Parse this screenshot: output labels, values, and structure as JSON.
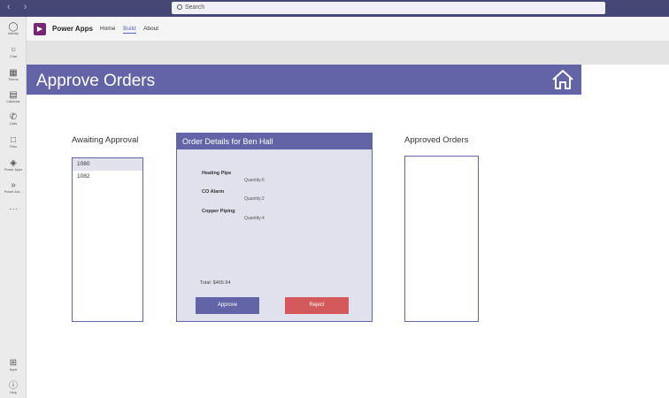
{
  "window": {
    "search_placeholder": "Search",
    "nav_arrows": "‹ ›"
  },
  "rail": {
    "items": [
      {
        "label": "Activity",
        "icon": "bell-icon"
      },
      {
        "label": "Chat",
        "icon": "chat-icon"
      },
      {
        "label": "Teams",
        "icon": "teams-icon"
      },
      {
        "label": "Calendar",
        "icon": "calendar-icon"
      },
      {
        "label": "Calls",
        "icon": "phone-icon"
      },
      {
        "label": "Files",
        "icon": "file-icon"
      },
      {
        "label": "Power Apps",
        "icon": "powerapps-icon"
      },
      {
        "label": "Power Aut...",
        "icon": "powerautomate-icon"
      }
    ],
    "more": "···",
    "apps_label": "Apps",
    "help_label": "Help"
  },
  "app": {
    "name": "Power Apps",
    "tabs": [
      {
        "label": "Home"
      },
      {
        "label": "Build"
      },
      {
        "label": "About"
      }
    ],
    "active_tab": "Build"
  },
  "screen": {
    "title": "Approve Orders",
    "awaiting_label": "Awaiting Approval",
    "awaiting_orders": [
      "1080",
      "1082"
    ],
    "approved_label": "Approved Orders",
    "approved_orders": [],
    "details": {
      "header": "Order Details for Ben Hall",
      "items": [
        {
          "name": "Heating Pipe",
          "qty": "Quantity:6"
        },
        {
          "name": "CO Alarm",
          "qty": "Quantity:2"
        },
        {
          "name": "Copper Piping",
          "qty": "Quantity:4"
        }
      ],
      "total": "Total: $465.94",
      "approve_label": "Approve",
      "reject_label": "Reject"
    }
  },
  "colors": {
    "accent": "#6264a7",
    "reject": "#d4595a",
    "titlebar": "#464775"
  }
}
